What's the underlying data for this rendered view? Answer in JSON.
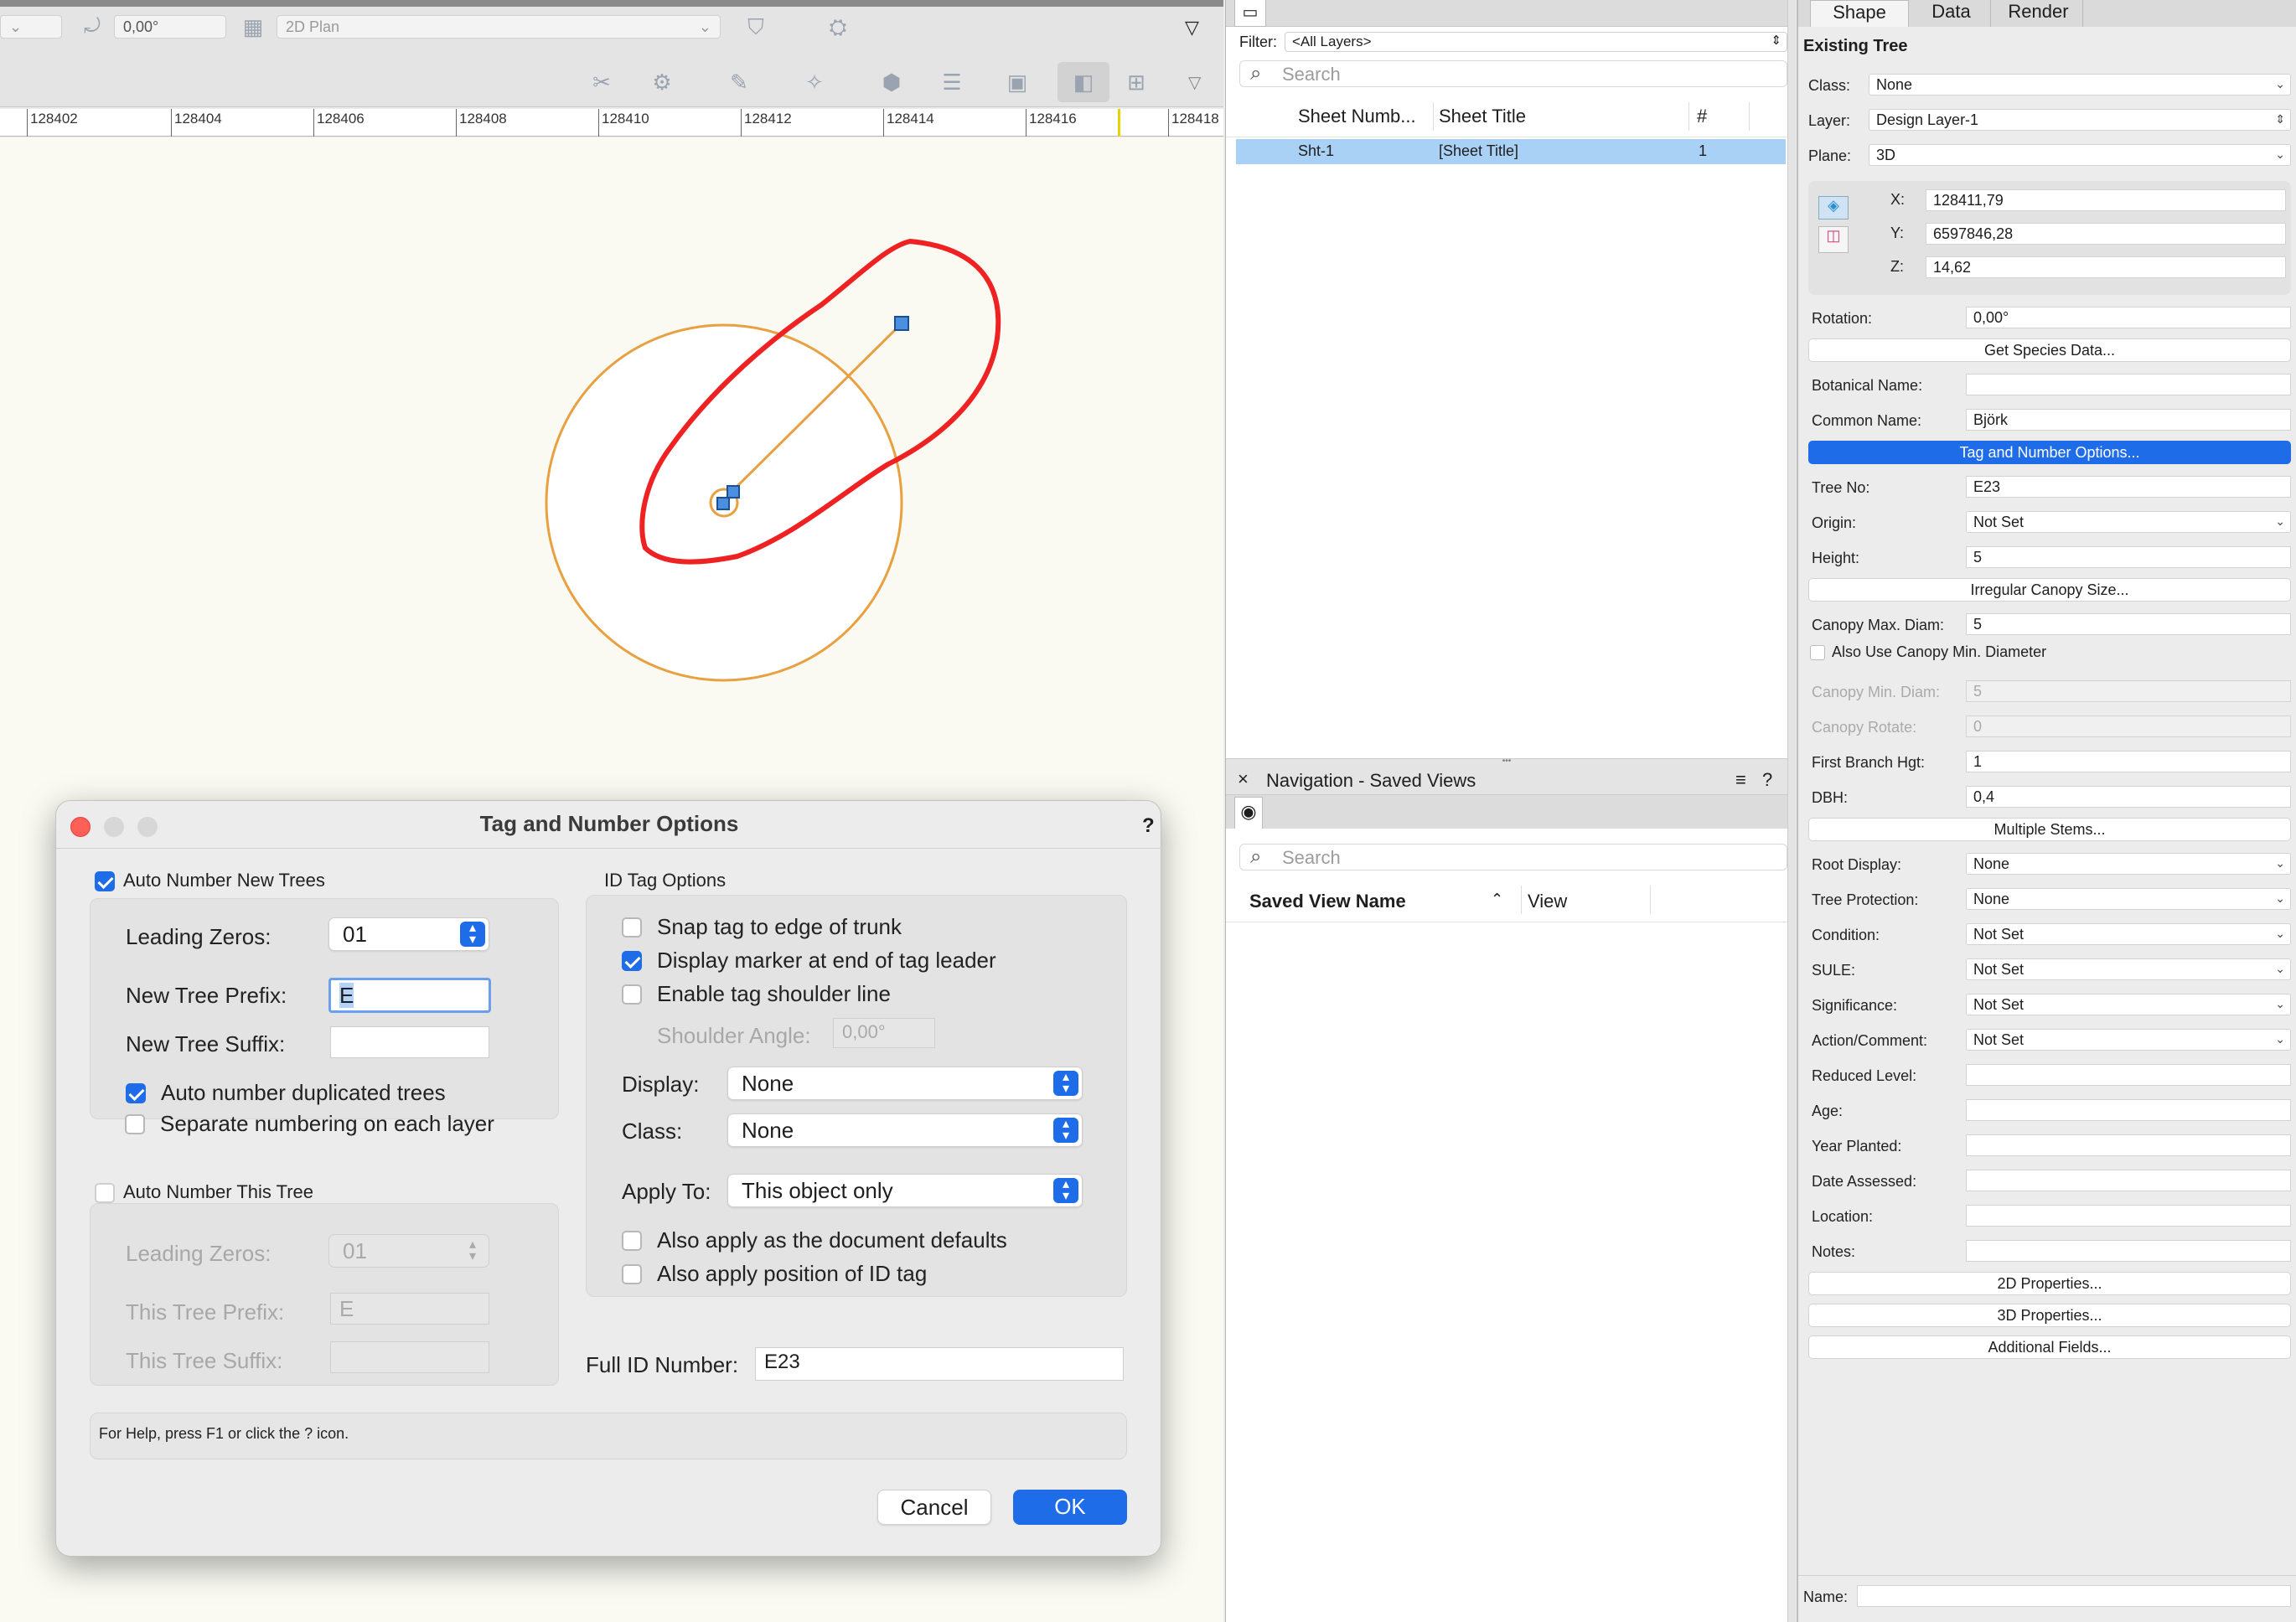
{
  "toolbar": {
    "rotation_value": "0,00°",
    "view_select": "2D Plan"
  },
  "ruler": {
    "labels": [
      "128402",
      "128404",
      "128406",
      "128408",
      "128410",
      "128412",
      "128414",
      "128416",
      "128418"
    ]
  },
  "dialog": {
    "title": "Tag and Number Options",
    "help_mark": "?",
    "auto_number_new_trees": "Auto Number New Trees",
    "leading_zeros_label": "Leading Zeros:",
    "leading_zeros_value": "01",
    "new_prefix_label": "New Tree Prefix:",
    "new_prefix_value": "E",
    "new_suffix_label": "New Tree Suffix:",
    "new_suffix_value": "",
    "auto_number_duplicated": "Auto number duplicated trees",
    "separate_numbering": "Separate numbering on each layer",
    "auto_number_this_tree": "Auto Number This Tree",
    "this_leading_zeros_label": "Leading Zeros:",
    "this_leading_zeros_value": "01",
    "this_prefix_label": "This Tree Prefix:",
    "this_prefix_value": "E",
    "this_suffix_label": "This Tree Suffix:",
    "this_suffix_value": "",
    "id_tag_options": "ID Tag Options",
    "snap_tag": "Snap tag to edge of trunk",
    "display_marker": "Display marker at end of tag leader",
    "enable_shoulder": "Enable tag shoulder line",
    "shoulder_angle_label": "Shoulder Angle:",
    "shoulder_angle_value": "0,00°",
    "display_label": "Display:",
    "display_value": "None",
    "class_label": "Class:",
    "class_value": "None",
    "apply_to_label": "Apply To:",
    "apply_to_value": "This object only",
    "also_defaults": "Also apply as the document defaults",
    "also_position": "Also apply position of ID tag",
    "full_id_label": "Full ID Number:",
    "full_id_value": "E23",
    "help_text": "For Help, press F1 or click the ? icon.",
    "cancel": "Cancel",
    "ok": "OK"
  },
  "sheet_panel": {
    "filter_label": "Filter:",
    "filter_value": "<All Layers>",
    "search_placeholder": "Search",
    "col_number": "Sheet Numb...",
    "col_title": "Sheet Title",
    "col_hash": "#",
    "rows": [
      {
        "number": "Sht-1",
        "title": "[Sheet Title]",
        "count": "1"
      }
    ]
  },
  "nav_panel": {
    "title": "Navigation - Saved Views",
    "search_placeholder": "Search",
    "col_name": "Saved View Name",
    "col_view": "View"
  },
  "oi": {
    "tabs": [
      "Shape",
      "Data",
      "Render"
    ],
    "object_type": "Existing Tree",
    "class_label": "Class:",
    "class_value": "None",
    "layer_label": "Layer:",
    "layer_value": "Design Layer-1",
    "plane_label": "Plane:",
    "plane_value": "3D",
    "x_label": "X:",
    "x_value": "128411,79",
    "y_label": "Y:",
    "y_value": "6597846,28",
    "z_label": "Z:",
    "z_value": "14,62",
    "rotation_label": "Rotation:",
    "rotation_value": "0,00°",
    "get_species": "Get Species Data...",
    "botanical_label": "Botanical Name:",
    "botanical_value": "",
    "common_label": "Common Name:",
    "common_value": "Björk",
    "tag_options": "Tag and Number Options...",
    "tree_no_label": "Tree No:",
    "tree_no_value": "E23",
    "origin_label": "Origin:",
    "origin_value": "Not Set",
    "height_label": "Height:",
    "height_value": "5",
    "irregular_canopy": "Irregular Canopy Size...",
    "canopy_max_label": "Canopy Max. Diam:",
    "canopy_max_value": "5",
    "also_canopy_min": "Also Use Canopy Min. Diameter",
    "canopy_min_label": "Canopy Min. Diam:",
    "canopy_min_value": "5",
    "canopy_rotate_label": "Canopy Rotate:",
    "canopy_rotate_value": "0",
    "first_branch_label": "First Branch Hgt:",
    "first_branch_value": "1",
    "dbh_label": "DBH:",
    "dbh_value": "0,4",
    "multiple_stems": "Multiple Stems...",
    "root_display_label": "Root Display:",
    "root_display_value": "None",
    "tree_protection_label": "Tree Protection:",
    "tree_protection_value": "None",
    "condition_label": "Condition:",
    "condition_value": "Not Set",
    "sule_label": "SULE:",
    "sule_value": "Not Set",
    "significance_label": "Significance:",
    "significance_value": "Not Set",
    "action_label": "Action/Comment:",
    "action_value": "Not Set",
    "reduced_label": "Reduced Level:",
    "age_label": "Age:",
    "year_planted_label": "Year Planted:",
    "date_assessed_label": "Date Assessed:",
    "location_label": "Location:",
    "notes_label": "Notes:",
    "props_2d": "2D Properties...",
    "props_3d": "3D Properties...",
    "additional_fields": "Additional Fields...",
    "name_label": "Name:"
  },
  "colors": {
    "accent": "#1e6ce8",
    "selection_row": "#a9d0f5",
    "canopy_stroke": "#e8a040",
    "annotation_red": "#ee2222"
  }
}
